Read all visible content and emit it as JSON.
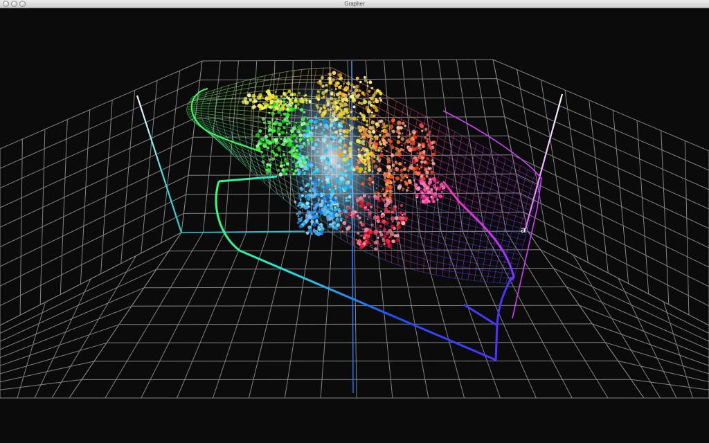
{
  "window": {
    "title": "Grapher"
  },
  "plot": {
    "background_color": "#0b0b0b",
    "grid_color": "#9a9a9a",
    "axis_label": "a"
  }
}
